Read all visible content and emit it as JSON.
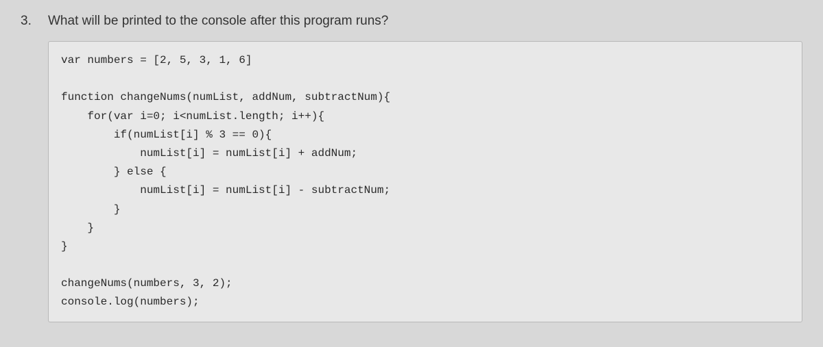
{
  "question": {
    "number": "3.",
    "prompt": "What will be printed to the console after this program runs?",
    "code": "var numbers = [2, 5, 3, 1, 6]\n\nfunction changeNums(numList, addNum, subtractNum){\n    for(var i=0; i<numList.length; i++){\n        if(numList[i] % 3 == 0){\n            numList[i] = numList[i] + addNum;\n        } else {\n            numList[i] = numList[i] - subtractNum;\n        }\n    }\n}\n\nchangeNums(numbers, 3, 2);\nconsole.log(numbers);"
  }
}
